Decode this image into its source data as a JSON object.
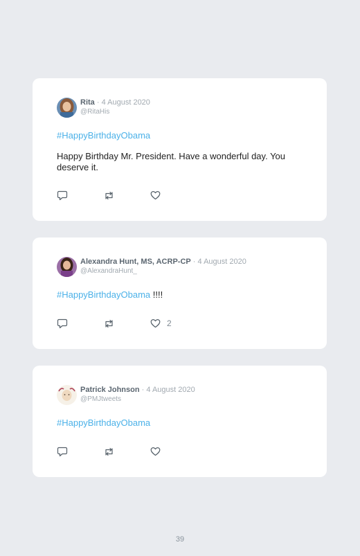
{
  "tweets": [
    {
      "name": "Rita",
      "date": "4 August 2020",
      "handle": "@RitaHis",
      "hashtag": "#HappyBirthdayObama",
      "text": "Happy Birthday Mr. President. Have a wonderful day. You deserve it.",
      "likes": ""
    },
    {
      "name": "Alexandra Hunt, MS, ACRP-CP",
      "date": "4 August 2020",
      "handle": "@AlexandraHunt_",
      "hashtag": "#HappyBirthdayObama",
      "text": "!!!!",
      "likes": "2"
    },
    {
      "name": "Patrick Johnson",
      "date": "4 August 2020",
      "handle": "@PMJtweets",
      "hashtag": "#HappyBirthdayObama",
      "text": "",
      "likes": ""
    }
  ],
  "separator": "·",
  "page_number": "39",
  "icons": {
    "reply": "reply-icon",
    "retweet": "retweet-icon",
    "like": "heart-icon"
  },
  "colors": {
    "background": "#e9ebef",
    "card": "#ffffff",
    "hashtag": "#4bb1e8",
    "name": "#5b6670",
    "muted": "#a1a9b0"
  }
}
